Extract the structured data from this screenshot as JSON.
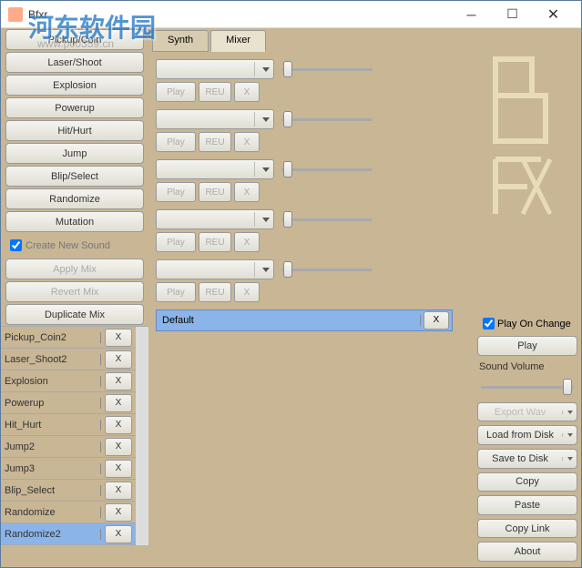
{
  "window": {
    "title": "Bfxr"
  },
  "watermark": {
    "text": "河东软件园",
    "url": "www.pc0359.cn"
  },
  "sidebar": {
    "buttons": [
      {
        "label": "Pickup/Coin"
      },
      {
        "label": "Laser/Shoot"
      },
      {
        "label": "Explosion"
      },
      {
        "label": "Powerup"
      },
      {
        "label": "Hit/Hurt"
      },
      {
        "label": "Jump"
      },
      {
        "label": "Blip/Select"
      },
      {
        "label": "Randomize"
      },
      {
        "label": "Mutation"
      }
    ],
    "create_new_sound": "Create New Sound",
    "apply_mix": "Apply Mix",
    "revert_mix": "Revert Mix",
    "duplicate_mix": "Duplicate Mix",
    "sounds": [
      {
        "name": "Pickup_Coin2",
        "x": "X"
      },
      {
        "name": "Laser_Shoot2",
        "x": "X"
      },
      {
        "name": "Explosion",
        "x": "X"
      },
      {
        "name": "Powerup",
        "x": "X"
      },
      {
        "name": "Hit_Hurt",
        "x": "X"
      },
      {
        "name": "Jump2",
        "x": "X"
      },
      {
        "name": "Jump3",
        "x": "X"
      },
      {
        "name": "Blip_Select",
        "x": "X"
      },
      {
        "name": "Randomize",
        "x": "X"
      },
      {
        "name": "Randomize2",
        "x": "X",
        "selected": true
      }
    ]
  },
  "tabs": {
    "synth": "Synth",
    "mixer": "Mixer"
  },
  "mixer": {
    "channels": [
      {
        "play": "Play",
        "rev": "REU",
        "x": "X"
      },
      {
        "play": "Play",
        "rev": "REU",
        "x": "X"
      },
      {
        "play": "Play",
        "rev": "REU",
        "x": "X"
      },
      {
        "play": "Play",
        "rev": "REU",
        "x": "X"
      },
      {
        "play": "Play",
        "rev": "REU",
        "x": "X"
      }
    ],
    "default_name": "Default",
    "default_x": "X"
  },
  "right": {
    "play_on_change": "Play On Change",
    "play": "Play",
    "sound_volume": "Sound Volume",
    "export_wav": "Export Wav",
    "load_from_disk": "Load from Disk",
    "save_to_disk": "Save to Disk",
    "copy": "Copy",
    "paste": "Paste",
    "copy_link": "Copy Link",
    "about": "About"
  }
}
